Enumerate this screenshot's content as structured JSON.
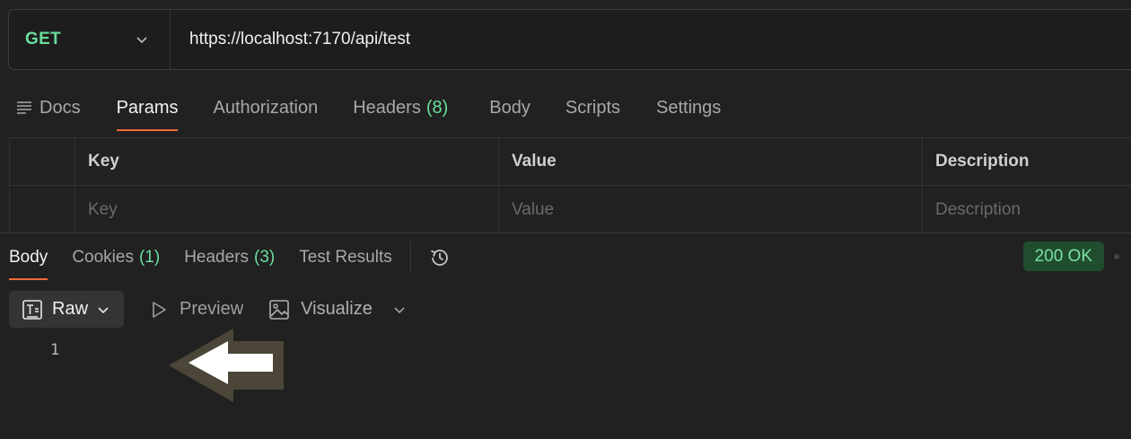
{
  "request": {
    "method": "GET",
    "url": "https://localhost:7170/api/test"
  },
  "request_tabs": [
    {
      "label": "Docs"
    },
    {
      "label": "Params",
      "active": true
    },
    {
      "label": "Authorization"
    },
    {
      "label": "Headers",
      "count": "(8)"
    },
    {
      "label": "Body"
    },
    {
      "label": "Scripts"
    },
    {
      "label": "Settings"
    }
  ],
  "params_table": {
    "headers": [
      "Key",
      "Value",
      "Description"
    ],
    "placeholders": {
      "key": "Key",
      "value": "Value",
      "description": "Description"
    }
  },
  "response_tabs": [
    {
      "label": "Body",
      "active": true
    },
    {
      "label": "Cookies",
      "count": "(1)"
    },
    {
      "label": "Headers",
      "count": "(3)"
    },
    {
      "label": "Test Results"
    }
  ],
  "status": "200 OK",
  "format_bar": {
    "raw": "Raw",
    "preview": "Preview",
    "visualize": "Visualize"
  },
  "editor": {
    "line_numbers": [
      "1"
    ]
  },
  "colors": {
    "accent": "#ef6a3a",
    "method_green": "#6bdd9a",
    "status_bg": "#1f4d2e"
  },
  "icons": [
    "chevron-down-icon",
    "docs-lines-icon",
    "history-icon",
    "raw-text-icon",
    "play-icon",
    "image-icon",
    "arrow-left-icon"
  ]
}
